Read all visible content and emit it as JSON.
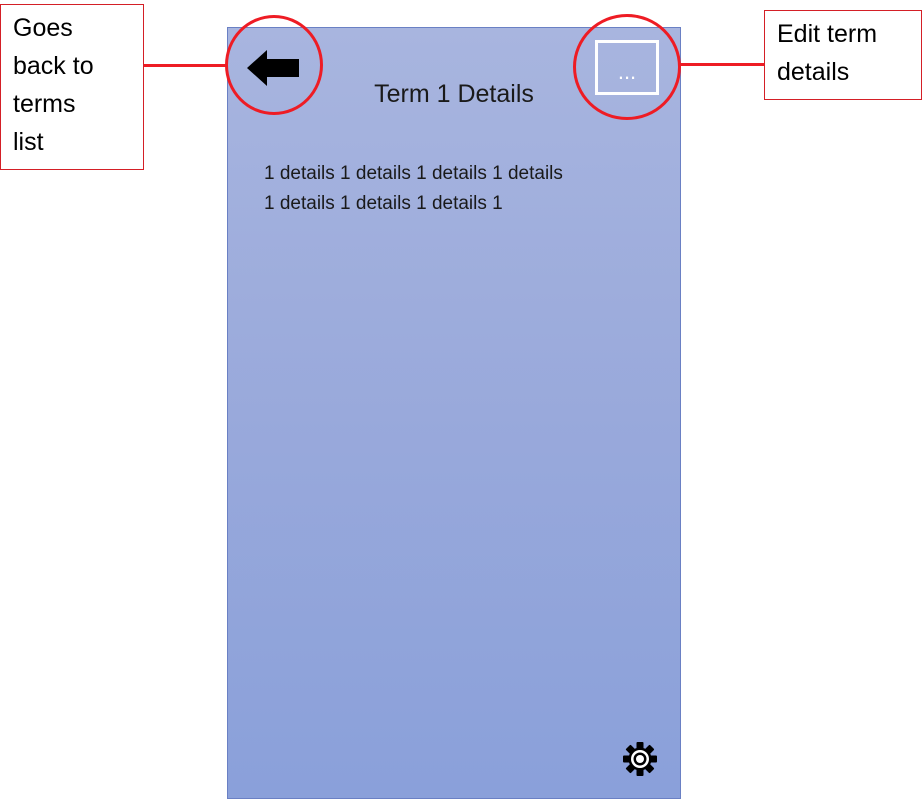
{
  "screen": {
    "title": "Term 1 Details",
    "more_label": "...",
    "details_lines": [
      "1 details 1 details 1 details 1 details",
      "1 details 1 details 1 details 1"
    ]
  },
  "icons": {
    "back": "arrow-left-icon",
    "more": "ellipsis-icon",
    "settings": "gear-icon"
  },
  "callouts": {
    "back": [
      "Goes",
      "back to",
      "terms",
      "list"
    ],
    "edit": [
      "Edit term",
      "details"
    ]
  },
  "colors": {
    "annotation": "#ee1c24",
    "screen_top": "#a8b5df",
    "screen_bottom": "#8aa0da"
  }
}
